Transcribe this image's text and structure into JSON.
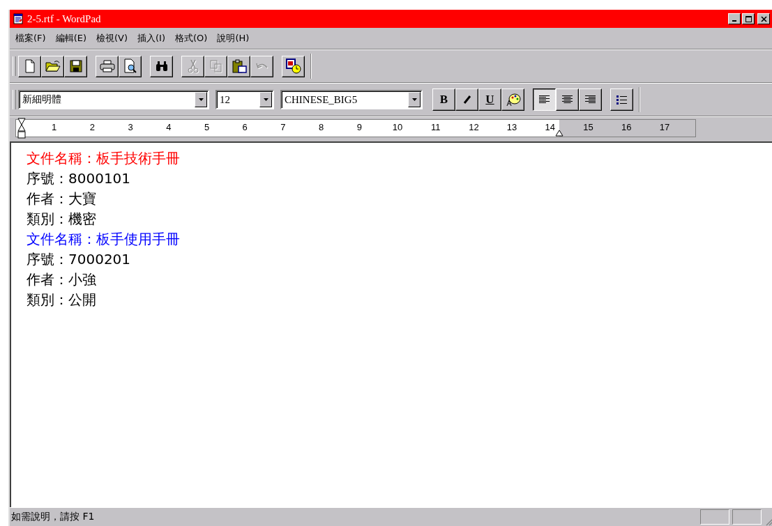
{
  "window": {
    "title": "2-5.rtf - WordPad"
  },
  "menu": [
    "檔案(F)",
    "編輯(E)",
    "檢視(V)",
    "插入(I)",
    "格式(O)",
    "說明(H)"
  ],
  "toolbar": [
    {
      "kind": "new",
      "disabled": false
    },
    {
      "kind": "open",
      "disabled": false
    },
    {
      "kind": "save",
      "disabled": false
    },
    {
      "kind": "sep"
    },
    {
      "kind": "print",
      "disabled": false
    },
    {
      "kind": "preview",
      "disabled": false
    },
    {
      "kind": "sep"
    },
    {
      "kind": "find",
      "disabled": false
    },
    {
      "kind": "sep"
    },
    {
      "kind": "cut",
      "disabled": true
    },
    {
      "kind": "copy",
      "disabled": true
    },
    {
      "kind": "paste",
      "disabled": false
    },
    {
      "kind": "undo",
      "disabled": true
    },
    {
      "kind": "sep"
    },
    {
      "kind": "datetime",
      "disabled": false
    }
  ],
  "format_bar": {
    "font": "新細明體",
    "size": "12",
    "script": "CHINESE_BIG5",
    "buttons": [
      {
        "kind": "bold",
        "label": "B",
        "selected": false
      },
      {
        "kind": "italic",
        "selected": false
      },
      {
        "kind": "underline",
        "label": "U",
        "selected": false
      },
      {
        "kind": "color",
        "selected": false
      },
      {
        "kind": "sep"
      },
      {
        "kind": "left",
        "selected": true
      },
      {
        "kind": "center",
        "selected": false
      },
      {
        "kind": "right",
        "selected": false
      },
      {
        "kind": "sep"
      },
      {
        "kind": "bullets",
        "selected": false
      }
    ]
  },
  "ruler": {
    "labels": [
      "1",
      "2",
      "3",
      "4",
      "5",
      "6",
      "7",
      "8",
      "9",
      "10",
      "11",
      "12",
      "13",
      "14",
      "15",
      "16",
      "17"
    ],
    "level": 0.8
  },
  "document": [
    {
      "text": "文件名稱：板手技術手冊",
      "color": "#ff0000"
    },
    {
      "text": "序號：8000101",
      "color": "#000000"
    },
    {
      "text": "作者：大寶",
      "color": "#000000"
    },
    {
      "text": "類別：機密",
      "color": "#000000"
    },
    {
      "text": "文件名稱：板手使用手冊",
      "color": "#0000ff"
    },
    {
      "text": "序號：7000201",
      "color": "#000000"
    },
    {
      "text": "作者：小強",
      "color": "#000000"
    },
    {
      "text": "類別：公開",
      "color": "#000000"
    }
  ],
  "status_bar": {
    "text": "如需說明，請按 F1"
  }
}
